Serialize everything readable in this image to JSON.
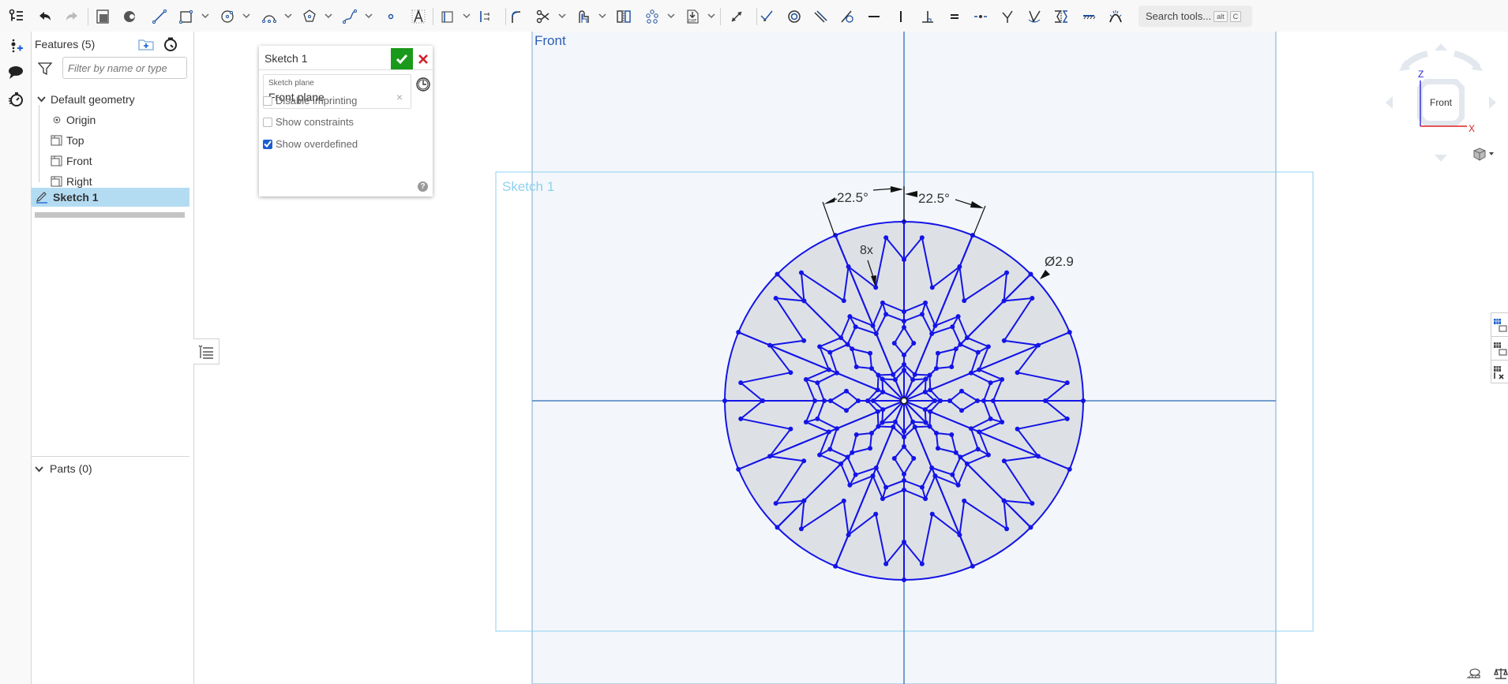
{
  "toolbar": {
    "tools": [
      {
        "name": "feature-list-toggle",
        "icon": "feature-list-icon"
      },
      {
        "name": "undo",
        "icon": "undo-icon"
      },
      {
        "name": "redo",
        "icon": "redo-icon"
      },
      {
        "name": "use-sketch",
        "icon": "use-icon"
      },
      {
        "name": "intersect",
        "icon": "intersect-icon"
      },
      {
        "name": "line",
        "icon": "line-icon"
      },
      {
        "name": "rectangle",
        "icon": "rectangle-icon",
        "dropdown": true
      },
      {
        "name": "circle",
        "icon": "circle-icon",
        "dropdown": true
      },
      {
        "name": "arc",
        "icon": "arc-icon",
        "dropdown": true
      },
      {
        "name": "polygon",
        "icon": "polygon-icon",
        "dropdown": true
      },
      {
        "name": "spline",
        "icon": "spline-icon",
        "dropdown": true
      },
      {
        "name": "point",
        "icon": "point-icon"
      },
      {
        "name": "text",
        "icon": "text-icon"
      },
      {
        "name": "construction",
        "icon": "construction-icon",
        "dropdown": true
      },
      {
        "name": "slot",
        "icon": "slot-icon"
      },
      {
        "name": "fillet",
        "icon": "fillet-icon"
      },
      {
        "name": "trim",
        "icon": "trim-icon",
        "dropdown": true
      },
      {
        "name": "offset",
        "icon": "offset-icon",
        "dropdown": true
      },
      {
        "name": "mirror",
        "icon": "mirror-icon"
      },
      {
        "name": "pattern",
        "icon": "pattern-icon",
        "dropdown": true
      },
      {
        "name": "dxf-import",
        "icon": "dxf-icon",
        "dropdown": true
      },
      {
        "name": "dimension",
        "icon": "dimension-icon"
      },
      {
        "name": "coincident",
        "icon": "coincident-icon"
      },
      {
        "name": "concentric",
        "icon": "concentric-icon"
      },
      {
        "name": "parallel",
        "icon": "parallel-icon"
      },
      {
        "name": "tangent",
        "icon": "tangent-icon"
      },
      {
        "name": "horizontal",
        "icon": "horizontal-icon"
      },
      {
        "name": "vertical",
        "icon": "vertical-icon"
      },
      {
        "name": "perpendicular",
        "icon": "perpendicular-icon"
      },
      {
        "name": "equal",
        "icon": "equal-icon"
      },
      {
        "name": "midpoint",
        "icon": "midpoint-icon"
      },
      {
        "name": "normal",
        "icon": "normal-icon"
      },
      {
        "name": "pierce",
        "icon": "pierce-icon"
      },
      {
        "name": "symmetric",
        "icon": "symmetric-icon"
      },
      {
        "name": "fix",
        "icon": "fix-icon"
      },
      {
        "name": "curvature",
        "icon": "curvature-icon"
      }
    ],
    "search_label": "Search tools...",
    "search_shortcut": [
      "alt",
      "C"
    ]
  },
  "left_strip": {
    "icons": [
      "insert-variable-icon",
      "comment-icon",
      "stopwatch-icon"
    ]
  },
  "feature_panel": {
    "title": "Features (5)",
    "filter_placeholder": "Filter by name or type",
    "tree": [
      {
        "label": "Default geometry",
        "type": "group",
        "expanded": true
      },
      {
        "label": "Origin",
        "type": "origin"
      },
      {
        "label": "Top",
        "type": "plane"
      },
      {
        "label": "Front",
        "type": "plane"
      },
      {
        "label": "Right",
        "type": "plane"
      },
      {
        "label": "Sketch 1",
        "type": "sketch",
        "selected": true
      }
    ],
    "parts_label": "Parts (0)"
  },
  "sketch_dialog": {
    "title": "Sketch 1",
    "plane_label": "Sketch plane",
    "plane_value": "Front plane",
    "options": [
      {
        "label": "Disable imprinting",
        "checked": false
      },
      {
        "label": "Show constraints",
        "checked": false
      },
      {
        "label": "Show overdefined",
        "checked": true
      }
    ],
    "help": "?"
  },
  "viewport": {
    "plane_label": "Front",
    "sketch_label": "Sketch 1",
    "dimensions": {
      "angle_left": "22.5°",
      "angle_right": "22.5°",
      "pattern_count": "8x",
      "diameter": "Ø2.9"
    },
    "colors": {
      "sketch": "#1414e6",
      "plane_fill": "#f3f7fb",
      "plane_edge": "#a9c4e3",
      "axis": "#4a7fc0",
      "sketch_bbox": "#8fd0ef",
      "region_fill": "#dde1e6"
    }
  },
  "viewcube": {
    "face_label": "Front",
    "axis_z": "Z",
    "axis_x": "X"
  },
  "right_tools": [
    "section-view-icon",
    "view-options-icon",
    "named-views-icon"
  ],
  "bottom_right": [
    "measure-icon",
    "mass-properties-icon"
  ]
}
